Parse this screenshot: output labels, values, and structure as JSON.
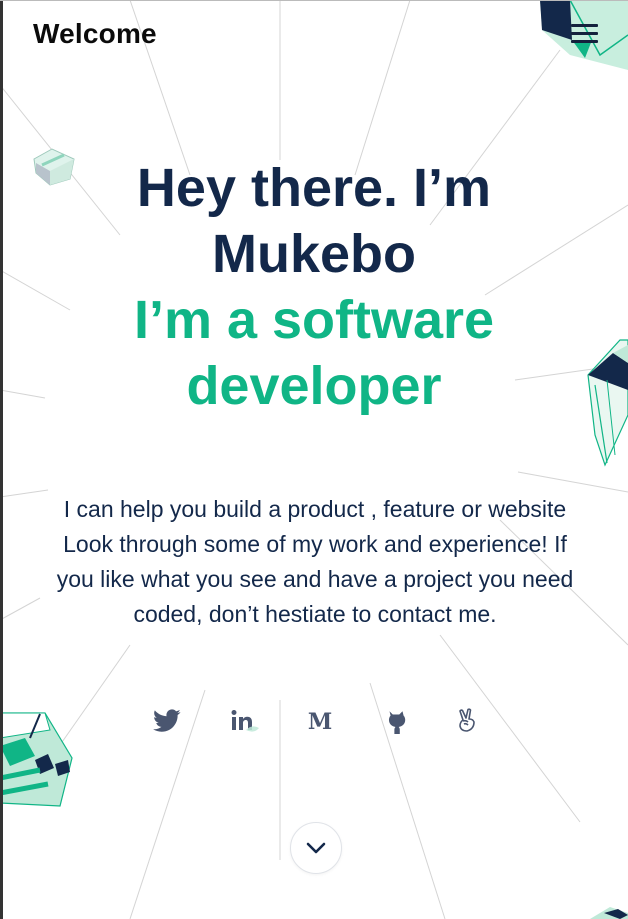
{
  "header": {
    "brand": "Welcome"
  },
  "hero": {
    "greeting_line1": "Hey there. I’m",
    "greeting_line2": "Mukebo",
    "role_line1": "I’m a software",
    "role_line2": "developer"
  },
  "intro": {
    "line1": "I can help you build a product , feature or website",
    "line2": "Look through some of my work and experience! If",
    "line3": "you like what you see and have a project you need",
    "line4": "coded, don’t hestiate to contact me."
  },
  "social": [
    {
      "icon": "twitter-icon"
    },
    {
      "icon": "linkedin-icon"
    },
    {
      "icon": "medium-icon"
    },
    {
      "icon": "github-icon"
    },
    {
      "icon": "angellist-icon"
    }
  ],
  "colors": {
    "navy": "#13284a",
    "green": "#10b586",
    "mint": "#bfe9d8"
  }
}
